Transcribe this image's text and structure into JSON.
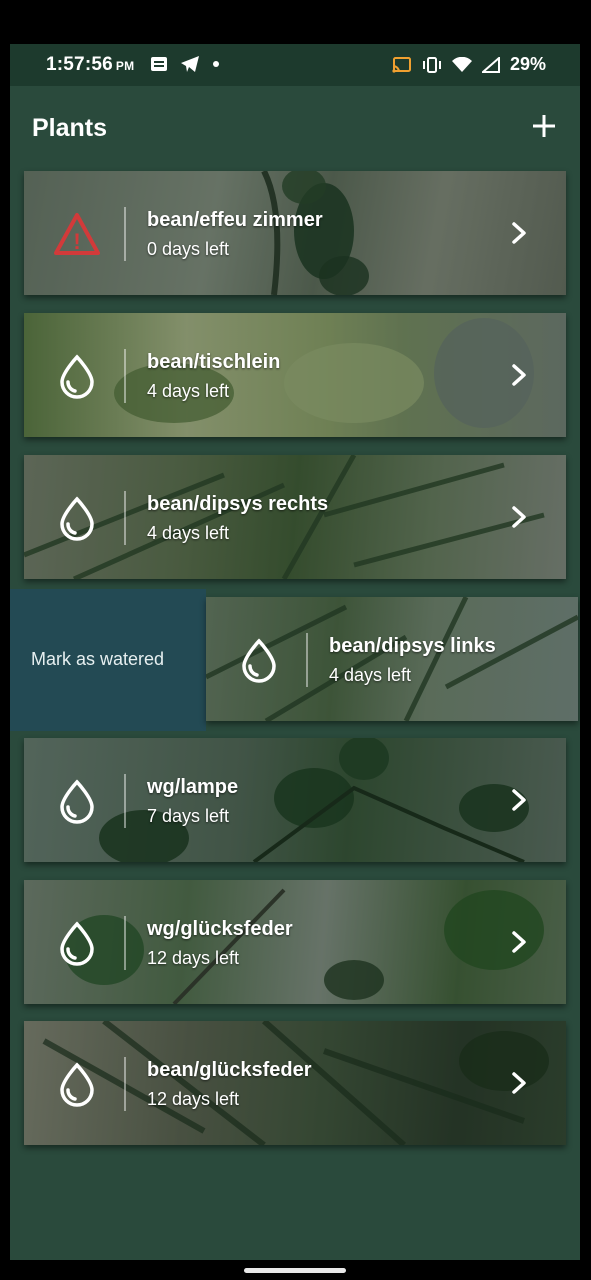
{
  "status_bar": {
    "time": "1:57:56",
    "ampm": "PM",
    "battery": "29%"
  },
  "app_bar": {
    "title": "Plants",
    "add_icon": "plus-icon"
  },
  "plants": [
    {
      "name": "bean/effeu zimmer",
      "days": "0 days left",
      "icon": "warning-icon"
    },
    {
      "name": "bean/tischlein",
      "days": "4 days left",
      "icon": "water-drop-icon"
    },
    {
      "name": "bean/dipsys rechts",
      "days": "4 days left",
      "icon": "water-drop-icon"
    },
    {
      "name": "bean/dipsys links",
      "days": "4 days left",
      "icon": "water-drop-icon"
    },
    {
      "name": "wg/lampe",
      "days": "7 days left",
      "icon": "water-drop-icon"
    },
    {
      "name": "wg/glücksfeder",
      "days": "12 days left",
      "icon": "water-drop-icon"
    },
    {
      "name": "bean/glücksfeder",
      "days": "12 days left",
      "icon": "water-drop-icon"
    }
  ],
  "swipe_action": {
    "label": "Mark as watered"
  },
  "colors": {
    "background": "#2a4a3c",
    "status_bar": "#1d3a2d",
    "swipe_action": "#234a54",
    "warning": "#d23a3a"
  }
}
